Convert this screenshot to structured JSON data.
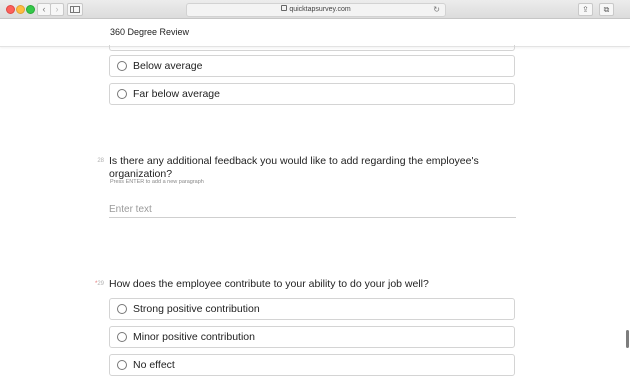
{
  "browser": {
    "url": "quicktapsurvey.com",
    "back_glyph": "‹",
    "forward_glyph": "›",
    "reload_glyph": "↻",
    "share_glyph": "⇪",
    "tabs_glyph": "⧉"
  },
  "header": {
    "title": "360 Degree Review"
  },
  "previous_question": {
    "options": [
      {
        "label": "Below average"
      },
      {
        "label": "Far below average"
      }
    ]
  },
  "question_28": {
    "number": "28",
    "text": "Is there any additional feedback you would like to add regarding the employee's organization?",
    "hint": "Press ENTER to add a new paragraph",
    "input_placeholder": "Enter text",
    "input_value": ""
  },
  "question_29": {
    "required_marker": "*",
    "number": "29",
    "text": "How does the employee contribute to your ability to do your job well?",
    "options": [
      {
        "label": "Strong positive contribution"
      },
      {
        "label": "Minor positive contribution"
      },
      {
        "label": "No effect"
      }
    ]
  },
  "colors": {
    "required": "#e57373",
    "border": "#d4d4d4",
    "text": "#222222"
  }
}
